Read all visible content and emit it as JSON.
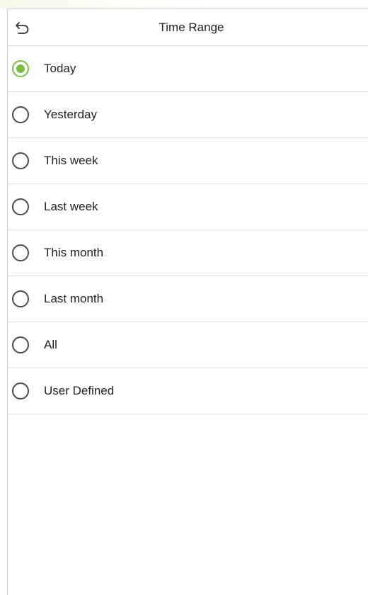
{
  "header": {
    "title": "Time Range",
    "back_icon": "back-arrow-icon"
  },
  "accent_color": "#7ac143",
  "options": [
    {
      "label": "Today",
      "selected": true
    },
    {
      "label": "Yesterday",
      "selected": false
    },
    {
      "label": "This week",
      "selected": false
    },
    {
      "label": "Last week",
      "selected": false
    },
    {
      "label": "This month",
      "selected": false
    },
    {
      "label": "Last month",
      "selected": false
    },
    {
      "label": "All",
      "selected": false
    },
    {
      "label": "User Defined",
      "selected": false
    }
  ]
}
